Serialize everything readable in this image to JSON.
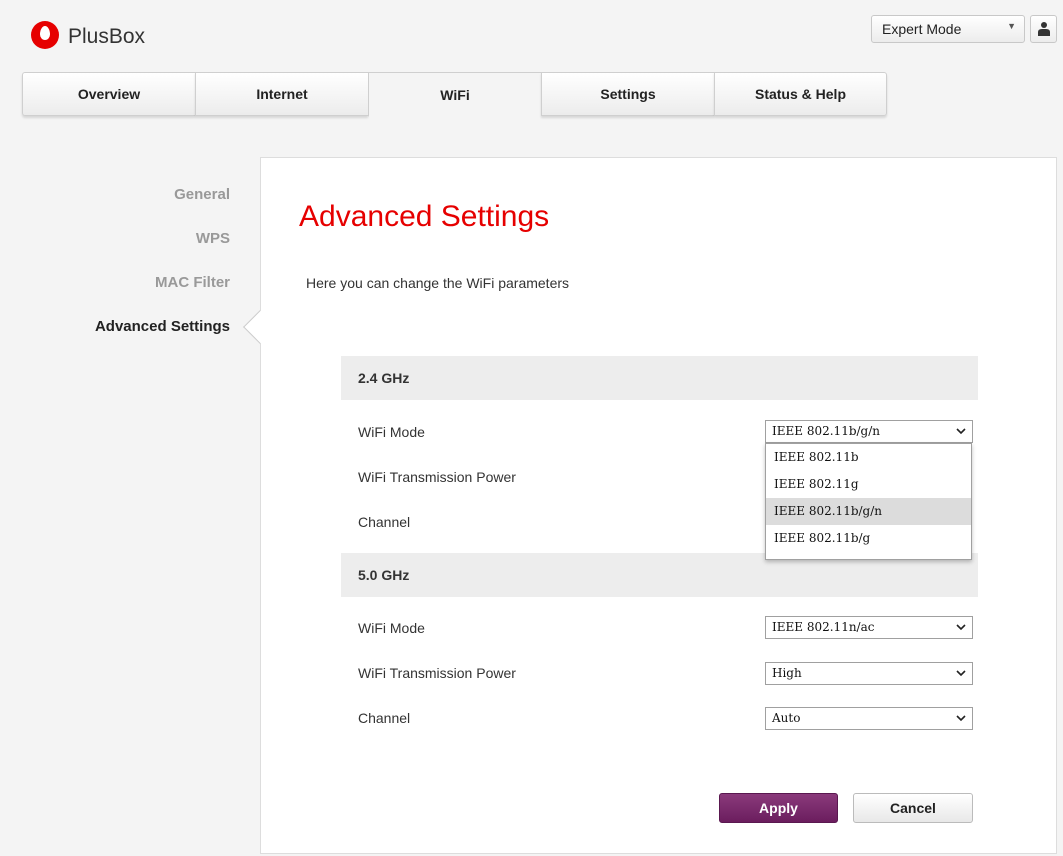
{
  "header": {
    "brand": "PlusBox",
    "mode_select": "Expert Mode",
    "icons": {
      "logo": "vodafone-logo",
      "user": "user-icon",
      "caret": "caret-down-icon"
    }
  },
  "nav": {
    "tabs": [
      {
        "label": "Overview"
      },
      {
        "label": "Internet"
      },
      {
        "label": "WiFi",
        "active": true
      },
      {
        "label": "Settings"
      },
      {
        "label": "Status & Help"
      }
    ]
  },
  "sidebar": {
    "items": [
      {
        "label": "General"
      },
      {
        "label": "WPS"
      },
      {
        "label": "MAC Filter"
      },
      {
        "label": "Advanced Settings",
        "active": true
      }
    ]
  },
  "main": {
    "title": "Advanced Settings",
    "subtitle": "Here you can change the WiFi parameters",
    "band_24": {
      "heading": "2.4 GHz",
      "wifi_mode_label": "WiFi Mode",
      "wifi_mode_value": "IEEE 802.11b/g/n",
      "wifi_mode_options": [
        "IEEE 802.11b",
        "IEEE 802.11g",
        "IEEE 802.11b/g/n",
        "IEEE 802.11b/g"
      ],
      "power_label": "WiFi Transmission Power",
      "channel_label": "Channel"
    },
    "band_50": {
      "heading": "5.0 GHz",
      "wifi_mode_label": "WiFi Mode",
      "wifi_mode_value": "IEEE 802.11n/ac",
      "power_label": "WiFi Transmission Power",
      "power_value": "High",
      "channel_label": "Channel",
      "channel_value": "Auto"
    },
    "apply_label": "Apply",
    "cancel_label": "Cancel"
  },
  "colors": {
    "brand_red": "#e60000",
    "apply_purple": "#7a2a6c"
  }
}
